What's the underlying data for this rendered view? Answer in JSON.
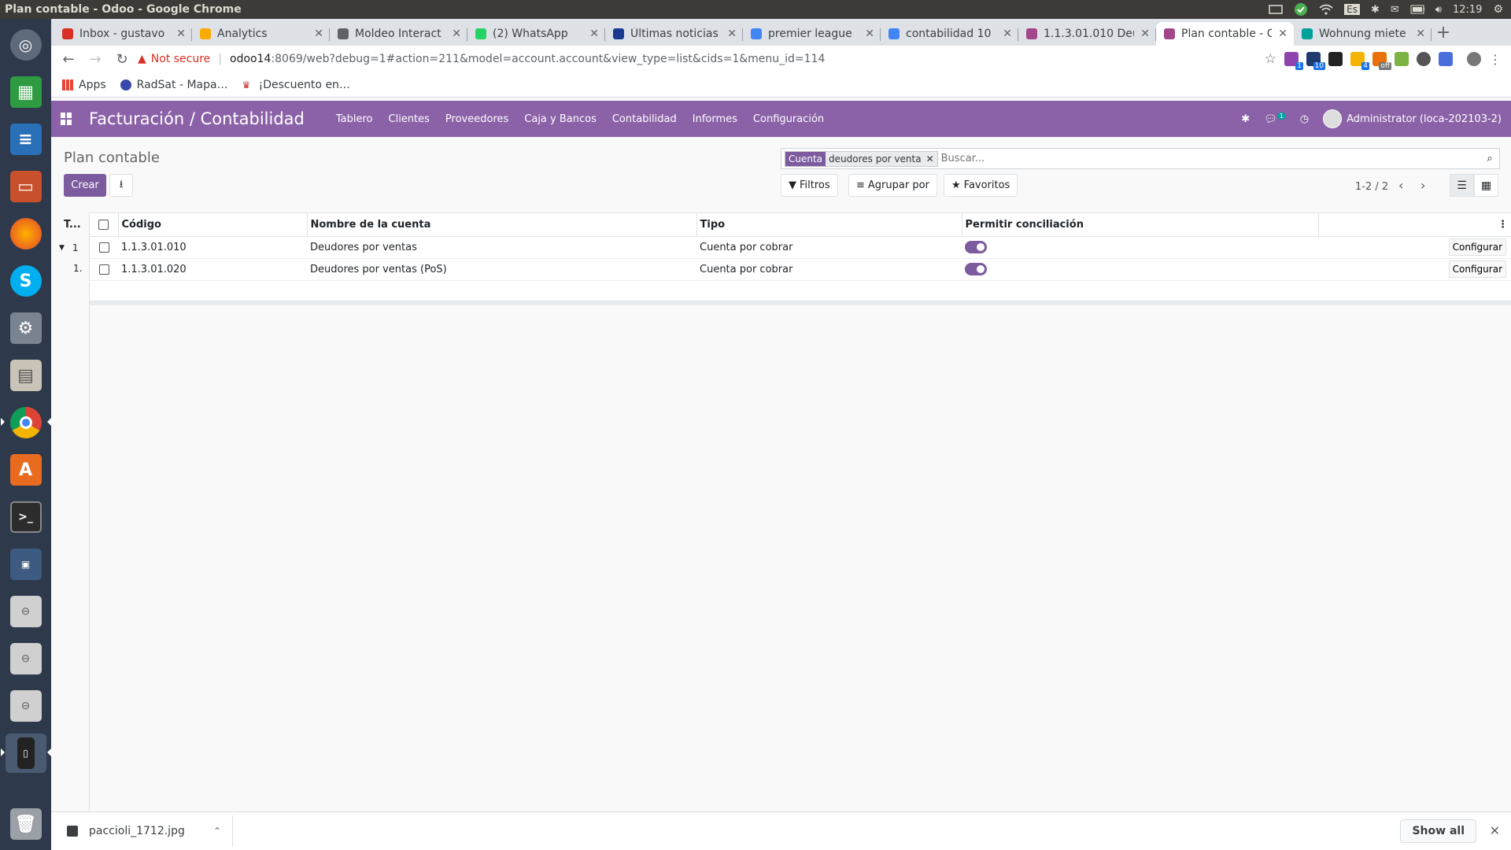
{
  "system": {
    "window_title": "Plan contable - Odoo - Google Chrome",
    "lang_indicator": "Es",
    "clock": "12:19"
  },
  "tabs": [
    {
      "title": "Inbox - gustavo",
      "color": "#d93025",
      "active": false
    },
    {
      "title": "Analytics",
      "color": "#f9ab00",
      "active": false
    },
    {
      "title": "Moldeo Interact",
      "color": "#5f6368",
      "active": false
    },
    {
      "title": "(2) WhatsApp",
      "color": "#25d366",
      "active": false
    },
    {
      "title": "Últimas noticias",
      "color": "#1a3a8f",
      "active": false
    },
    {
      "title": "premier league",
      "color": "#4285f4",
      "active": false
    },
    {
      "title": "contabilidad 10",
      "color": "#4285f4",
      "active": false
    },
    {
      "title": "1.1.3.01.010 Deu",
      "color": "#a24689",
      "active": false
    },
    {
      "title": "Plan contable - O",
      "color": "#a24689",
      "active": true
    },
    {
      "title": "Wohnung miete",
      "color": "#00a19a",
      "active": false
    }
  ],
  "address": {
    "security": "Not secure",
    "host": "odoo14",
    "path": ":8069/web?debug=1#action=211&model=account.account&view_type=list&cids=1&menu_id=114"
  },
  "extension_badges": [
    "1",
    "10",
    "4",
    "off"
  ],
  "bookmarks": [
    "Apps",
    "RadSat - Mapa…",
    "¡Descuento en…"
  ],
  "odoo": {
    "app_title": "Facturación / Contabilidad",
    "menu": [
      "Tablero",
      "Clientes",
      "Proveedores",
      "Caja y Bancos",
      "Contabilidad",
      "Informes",
      "Configuración"
    ],
    "chat_badge": "1",
    "user": "Administrator (loca-202103-2)",
    "breadcrumb": "Plan contable",
    "create_label": "Crear",
    "facet_key": "Cuenta",
    "facet_value": "deudores por venta",
    "search_placeholder": "Buscar...",
    "filters_label": "Filtros",
    "groupby_label": "Agrupar por",
    "favorites_label": "Favoritos",
    "pager": "1-2 / 2",
    "side_header": "T...",
    "side_rows": [
      "1",
      "1."
    ],
    "columns": [
      "Código",
      "Nombre de la cuenta",
      "Tipo",
      "Permitir conciliación"
    ],
    "rows": [
      {
        "code": "1.1.3.01.010",
        "name": "Deudores por ventas",
        "type": "Cuenta por cobrar",
        "reconcile": true,
        "action": "Configurar"
      },
      {
        "code": "1.1.3.01.020",
        "name": "Deudores por ventas (PoS)",
        "type": "Cuenta por cobrar",
        "reconcile": true,
        "action": "Configurar"
      }
    ],
    "accent": "#7c5b9e"
  },
  "download": {
    "file": "paccioli_1712.jpg",
    "show_all": "Show all"
  }
}
